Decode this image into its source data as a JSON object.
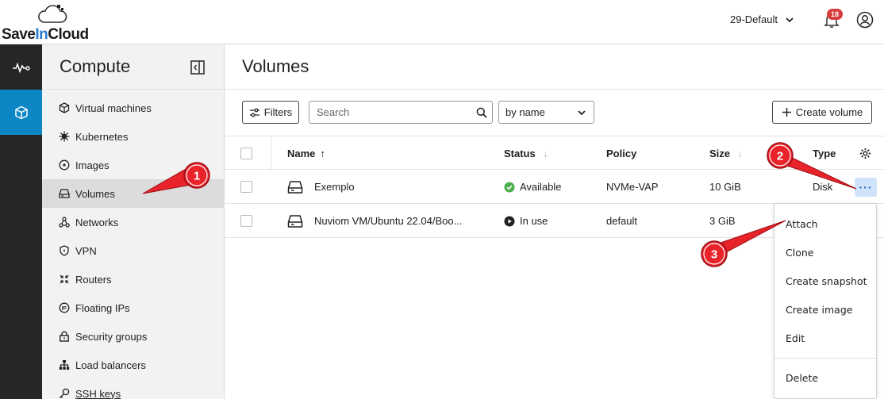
{
  "brand": {
    "part1": "Save",
    "part2": "In",
    "part3": "Cloud"
  },
  "header": {
    "tenant": "29-Default",
    "notification_count": "18"
  },
  "rail": {
    "items": [
      "monitoring-icon",
      "compute-icon"
    ],
    "active": 1
  },
  "sidebar": {
    "title": "Compute",
    "items": [
      {
        "label": "Virtual machines",
        "icon": "cube-icon"
      },
      {
        "label": "Kubernetes",
        "icon": "helm-icon"
      },
      {
        "label": "Images",
        "icon": "disc-icon"
      },
      {
        "label": "Volumes",
        "icon": "drive-icon",
        "active": true
      },
      {
        "label": "Networks",
        "icon": "network-icon"
      },
      {
        "label": "VPN",
        "icon": "shield-icon"
      },
      {
        "label": "Routers",
        "icon": "router-icon"
      },
      {
        "label": "Floating IPs",
        "icon": "ip-icon"
      },
      {
        "label": "Security groups",
        "icon": "lock-icon"
      },
      {
        "label": "Load balancers",
        "icon": "hierarchy-icon"
      },
      {
        "label": "SSH keys",
        "icon": "key-icon"
      }
    ]
  },
  "main": {
    "title": "Volumes",
    "filters_label": "Filters",
    "search_placeholder": "Search",
    "sort_value": "by name",
    "create_label": "Create volume"
  },
  "table": {
    "columns": {
      "name": "Name",
      "status": "Status",
      "policy": "Policy",
      "size": "Size",
      "type": "Type"
    },
    "rows": [
      {
        "name": "Exemplo",
        "status": "Available",
        "policy": "NVMe-VAP",
        "size": "10 GiB",
        "type": "Disk"
      },
      {
        "name": "Nuviom VM/Ubuntu 22.04/Boo...",
        "status": "In use",
        "policy": "default",
        "size": "3 GiB",
        "type": ""
      }
    ]
  },
  "menu": {
    "items": [
      "Attach",
      "Clone",
      "Create snapshot",
      "Create image",
      "Edit",
      "Delete"
    ]
  },
  "annotations": {
    "m1": "1",
    "m2": "2",
    "m3": "3"
  },
  "colors": {
    "accent": "#0d86c6",
    "rail": "#262626",
    "marker": "#e8232a",
    "available": "#4caf50",
    "badge": "#d93a3a"
  }
}
